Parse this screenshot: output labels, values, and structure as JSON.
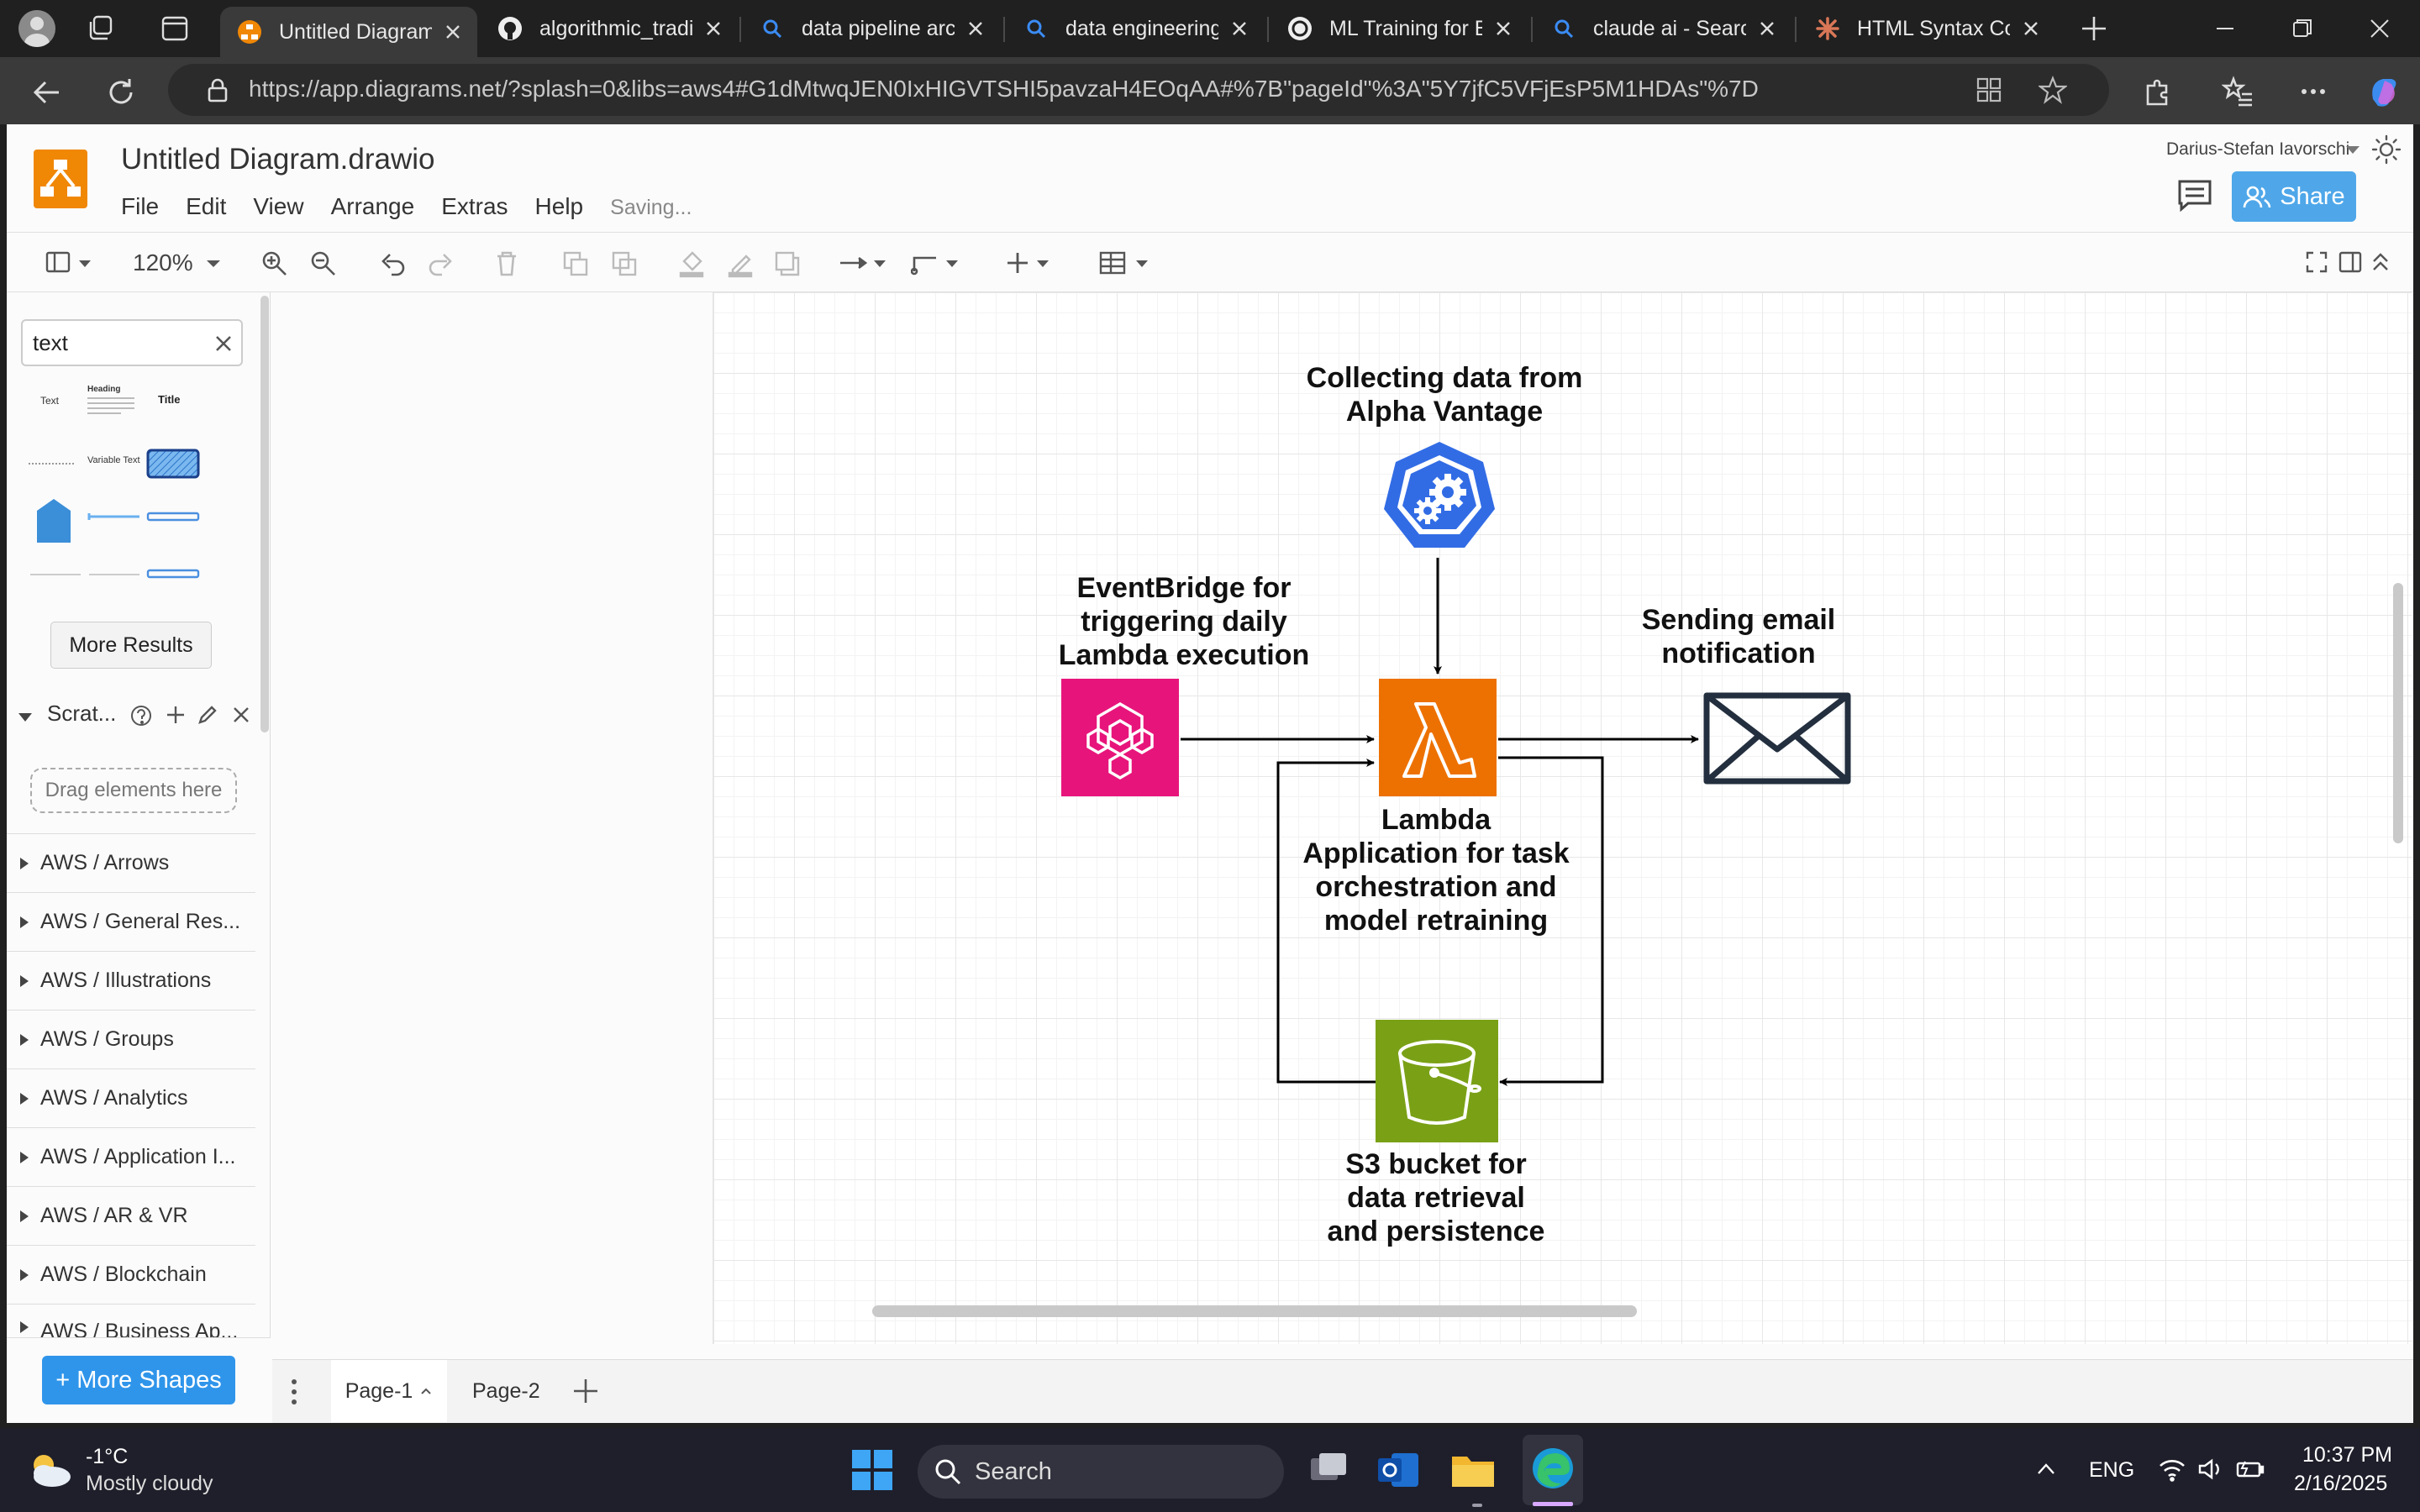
{
  "browser": {
    "tabs": [
      {
        "label": "Untitled Diagram.drawio",
        "active": true
      },
      {
        "label": "algorithmic_trading"
      },
      {
        "label": "data pipeline architecture"
      },
      {
        "label": "data engineering pipeline"
      },
      {
        "label": "ML Training for Bitcoin"
      },
      {
        "label": "claude ai - Search"
      },
      {
        "label": "HTML Syntax Correction"
      }
    ],
    "url": "https://app.diagrams.net/?splash=0&libs=aws4#G1dMtwqJEN0IxHIGVTSHI5pavzaH4EOqAA#%7B\"pageId\"%3A\"5Y7jfC5VFjEsP5M1HDAs\"%7D",
    "url_host": "app.diagrams.net"
  },
  "app": {
    "title": "Untitled Diagram.drawio",
    "menu": [
      "File",
      "Edit",
      "View",
      "Arrange",
      "Extras",
      "Help"
    ],
    "status": "Saving...",
    "user": "Darius-Stefan Iavorschi",
    "share_label": "Share",
    "zoom": "120%"
  },
  "sidebar": {
    "search_value": "text",
    "results": [
      "Text",
      "Heading",
      "Title",
      "Variable Text"
    ],
    "more_results": "More Results",
    "scratchpad_title": "Scrat...",
    "drop_hint": "Drag elements here",
    "sections": [
      "AWS / Arrows",
      "AWS / General Res...",
      "AWS / Illustrations",
      "AWS / Groups",
      "AWS / Analytics",
      "AWS / Application I...",
      "AWS / AR & VR",
      "AWS / Blockchain",
      "AWS / Business Ap..."
    ],
    "more_shapes": "+ More Shapes"
  },
  "diagram": {
    "alpha_label": "Collecting data from\nAlpha Vantage",
    "eventbridge_label": "EventBridge for\ntriggering daily\nLambda execution",
    "email_label": "Sending email\nnotification",
    "lambda_label": "Lambda\nApplication for task\norchestration and\nmodel retraining",
    "s3_label": "S3 bucket for\ndata retrieval\nand persistence",
    "colors": {
      "eventbridge": "#e7157b",
      "lambda": "#ed7100",
      "s3": "#7aa116",
      "alpha": "#326ce5",
      "email": "#232f3e"
    }
  },
  "pages": [
    "Page-1",
    "Page-2"
  ],
  "taskbar": {
    "temperature": "-1°C",
    "weather": "Mostly cloudy",
    "search": "Search",
    "language": "ENG",
    "time": "10:37 PM",
    "date": "2/16/2025"
  }
}
